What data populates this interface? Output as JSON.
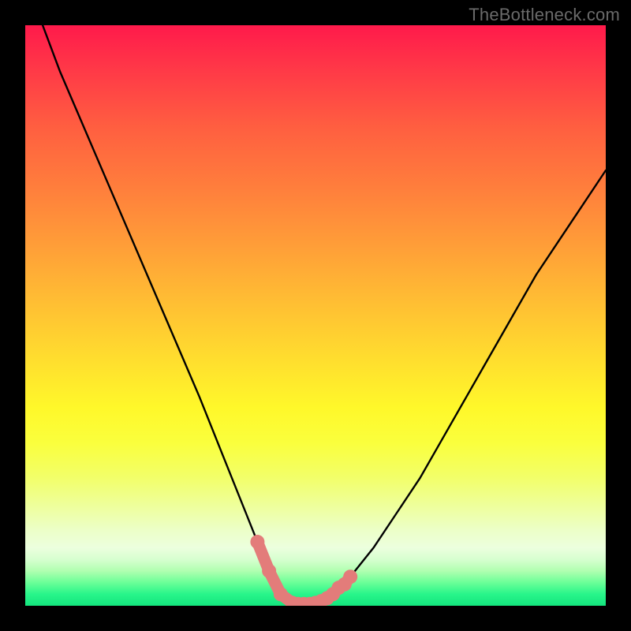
{
  "watermark": {
    "text": "TheBottleneck.com"
  },
  "colors": {
    "frame": "#000000",
    "curve_stroke": "#000000",
    "marker_stroke": "#e37c7a",
    "marker_fill": "#e37c7a"
  },
  "chart_data": {
    "type": "line",
    "title": "",
    "xlabel": "",
    "ylabel": "",
    "xlim": [
      0,
      100
    ],
    "ylim": [
      0,
      100
    ],
    "grid": false,
    "series": [
      {
        "name": "bottleneck-curve",
        "x": [
          0,
          3,
          6,
          9,
          12,
          15,
          18,
          21,
          24,
          27,
          30,
          32,
          34,
          36,
          38,
          40,
          42,
          44,
          46,
          48,
          50,
          53,
          56,
          60,
          64,
          68,
          72,
          76,
          80,
          84,
          88,
          92,
          96,
          100
        ],
        "values": [
          108,
          100,
          92,
          85,
          78,
          71,
          64,
          57,
          50,
          43,
          36,
          31,
          26,
          21,
          16,
          11,
          6,
          2,
          0.5,
          0.3,
          0.5,
          2,
          5,
          10,
          16,
          22,
          29,
          36,
          43,
          50,
          57,
          63,
          69,
          75
        ]
      }
    ],
    "highlight": {
      "name": "optimal-range",
      "x": [
        40,
        42,
        44,
        46,
        47,
        48,
        49,
        50,
        51,
        52,
        53,
        54,
        55,
        56
      ],
      "values": [
        11,
        6,
        2,
        0.5,
        0.3,
        0.3,
        0.3,
        0.5,
        0.8,
        1.3,
        2,
        3.1,
        3.7,
        5
      ]
    }
  }
}
